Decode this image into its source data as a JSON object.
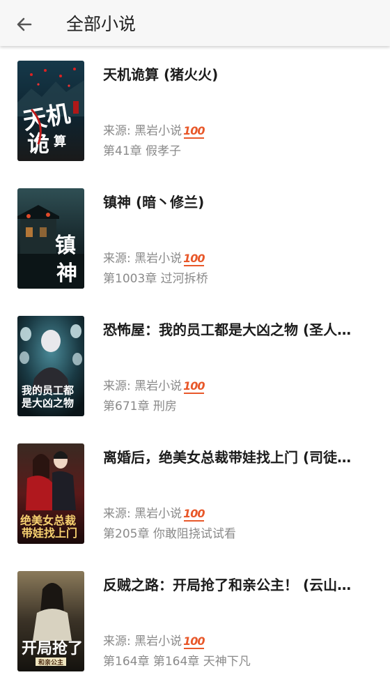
{
  "header": {
    "title": "全部小说",
    "back_icon": "back-arrow-icon"
  },
  "colors": {
    "title_text": "#1c1c1c",
    "meta_text": "#8a8a8a",
    "badge": "#e8582a",
    "topbar_bg": "#f7f7f7"
  },
  "books": [
    {
      "title": "天机诡算 (猪火火)",
      "source": "来源: 黑岩小说",
      "badge": "100",
      "chapter": "第41章 假孝子",
      "cover_text": "天机诡算",
      "cover_theme": [
        "#0e2430",
        "#3a4a52",
        "#b01818"
      ]
    },
    {
      "title": "镇神 (暗丶修兰)",
      "source": "来源: 黑岩小说",
      "badge": "100",
      "chapter": "第1003章 过河拆桥",
      "cover_text": "镇神",
      "cover_theme": [
        "#0d1a1e",
        "#2c4a44",
        "#d33a2a"
      ]
    },
    {
      "title": "恐怖屋：我的员工都是大凶之物 (圣人…",
      "source": "来源: 黑岩小说",
      "badge": "100",
      "chapter": "第671章 刑房",
      "cover_text": "我的员工都是大凶之物",
      "cover_theme": [
        "#0a1b22",
        "#2f6c7a",
        "#c8e2e8"
      ]
    },
    {
      "title": "离婚后，绝美女总裁带娃找上门 (司徒…",
      "source": "来源: 黑岩小说",
      "badge": "100",
      "chapter": "第205章 你敢阻挠试试看",
      "cover_text": "绝美女总裁带娃找上门",
      "cover_theme": [
        "#2a1010",
        "#8a2222",
        "#f0c060"
      ]
    },
    {
      "title": "反贼之路：开局抢了和亲公主！ (云山…",
      "source": "来源: 黑岩小说",
      "badge": "100",
      "chapter": "第164章 第164章 天神下凡",
      "cover_text": "开局抢了和亲公主",
      "cover_theme": [
        "#1c1a14",
        "#6b5b3a",
        "#e8d6a0"
      ]
    }
  ]
}
